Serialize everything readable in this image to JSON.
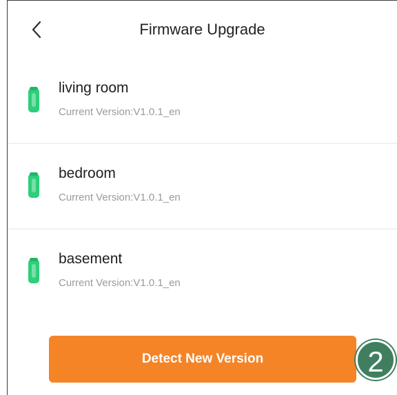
{
  "header": {
    "title": "Firmware Upgrade",
    "back_icon": "chevron-left-icon"
  },
  "devices": [
    {
      "name": "living room",
      "version": "Current Version:V1.0.1_en",
      "icon": "sensor-device-icon"
    },
    {
      "name": "bedroom",
      "version": "Current Version:V1.0.1_en",
      "icon": "sensor-device-icon"
    },
    {
      "name": "basement",
      "version": "Current Version:V1.0.1_en",
      "icon": "sensor-device-icon"
    }
  ],
  "actions": {
    "detect_label": "Detect New Version"
  },
  "annotation": {
    "step_number": "2"
  },
  "colors": {
    "accent": "#f58427",
    "device_green": "#2ecf7a",
    "badge": "#3f7f5f"
  }
}
